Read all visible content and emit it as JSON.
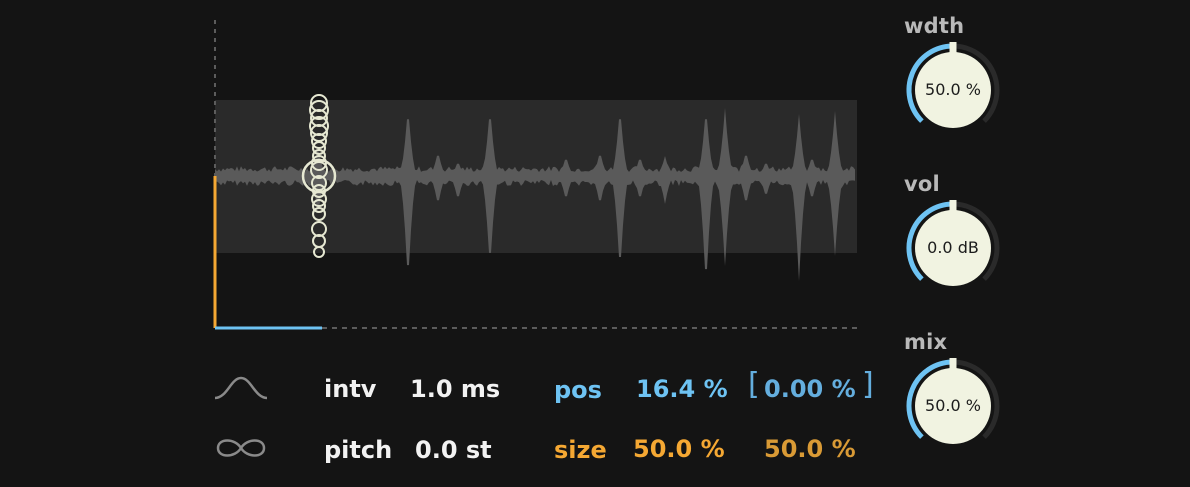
{
  "knobs": [
    {
      "title": "wdth",
      "value": "50.0 %",
      "level": 0.5
    },
    {
      "title": "vol",
      "value": "0.0 dB",
      "level": 0.5
    },
    {
      "title": "mix",
      "value": "50.0 %",
      "level": 0.5
    }
  ],
  "params": {
    "interval": {
      "label": "intv",
      "value": "1.0 ms"
    },
    "pitch": {
      "label": "pitch",
      "value": "0.0 st"
    },
    "position": {
      "label": "pos",
      "value": "16.4 %",
      "random": "0.00 %",
      "random_open": "[",
      "random_close": "]"
    },
    "size": {
      "label": "size",
      "value": "50.0 %",
      "random": "50.0 %"
    }
  },
  "icons": {
    "window_shape": "bell-curve-icon",
    "loop_mode": "infinity-icon"
  },
  "colors": {
    "background": "#141414",
    "accent_blue": "#6ec3f3",
    "accent_orange": "#f5a833",
    "knob_face": "#f1f3e1",
    "waveform": "#5a5a5a",
    "grain_circle": "#e6e8d2"
  },
  "display": {
    "position_fraction": 0.164,
    "size_fraction": 0.5,
    "grains": 18
  }
}
